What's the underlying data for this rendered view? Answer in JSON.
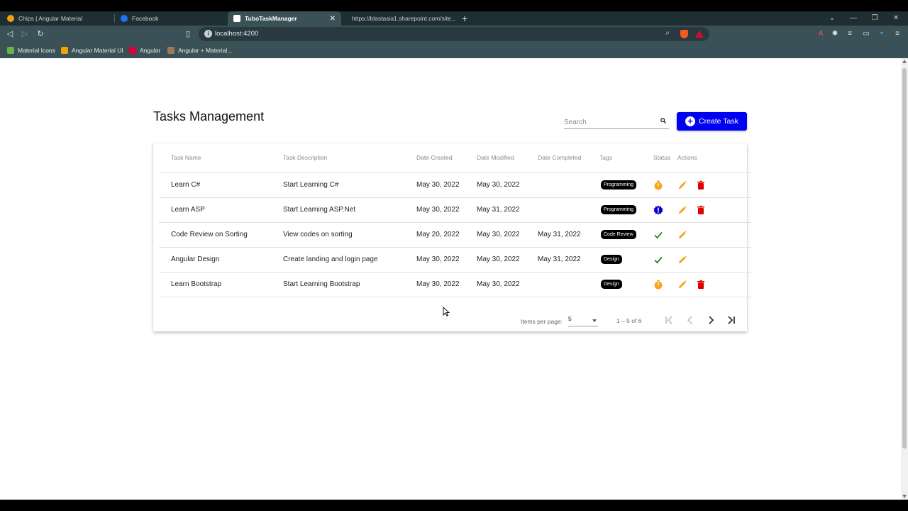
{
  "browser": {
    "tabs": [
      {
        "title": "Chips | Angular Material",
        "active": false,
        "icon": "angular-material-icon"
      },
      {
        "title": "Facebook",
        "active": false,
        "icon": "facebook-icon"
      },
      {
        "title": "TuboTaskManager",
        "active": true,
        "icon": "angular-icon"
      },
      {
        "title": "https://blastasia1.sharepoint.com/site...",
        "active": false,
        "icon": "sharepoint-icon"
      }
    ],
    "url": "localhost:4200",
    "bookmarks": [
      {
        "label": "Material Icons"
      },
      {
        "label": "Angular Material UI"
      },
      {
        "label": "Angular"
      },
      {
        "label": "Angular + Material..."
      }
    ]
  },
  "page": {
    "title": "Tasks Management",
    "search_placeholder": "Search",
    "create_label": "Create Task",
    "accent_color": "#0000f0"
  },
  "table": {
    "headers": {
      "name": "Task Name",
      "description": "Task Description",
      "created": "Date Created",
      "modified": "Date Modified",
      "completed": "Date Completed",
      "tags": "Tags",
      "status": "Status",
      "actions": "Actions"
    },
    "rows": [
      {
        "name": "Learn C#",
        "description": "Start Learning C#",
        "created": "May 30, 2022",
        "modified": "May 30, 2022",
        "completed": "",
        "tag": "Programming",
        "status": "timer-icon",
        "can_delete": true
      },
      {
        "name": "Learn ASP",
        "description": "Start Learning ASP.Net",
        "created": "May 30, 2022",
        "modified": "May 31, 2022",
        "completed": "",
        "tag": "Programming",
        "status": "new-releases-icon",
        "can_delete": true
      },
      {
        "name": "Code Review on Sorting",
        "description": "View codes on sorting",
        "created": "May 20, 2022",
        "modified": "May 30, 2022",
        "completed": "May 31, 2022",
        "tag": "Code Review",
        "status": "check-icon",
        "can_delete": false
      },
      {
        "name": "Angular Design",
        "description": "Create landing and login page",
        "created": "May 30, 2022",
        "modified": "May 30, 2022",
        "completed": "May 31, 2022",
        "tag": "Design",
        "status": "check-icon",
        "can_delete": false
      },
      {
        "name": "Learn Bootstrap",
        "description": "Start Learning Bootstrap",
        "created": "May 30, 2022",
        "modified": "May 30, 2022",
        "completed": "",
        "tag": "Design",
        "status": "timer-icon",
        "can_delete": true
      }
    ]
  },
  "paginator": {
    "items_per_page_label": "Items per page:",
    "items_per_page": "5",
    "range_label": "1 – 5 of 6"
  },
  "colors": {
    "edit": "#f2a51a",
    "delete": "#e00000",
    "check": "#2e7d32",
    "timer": "#f5a623",
    "new": "#0000d0"
  }
}
